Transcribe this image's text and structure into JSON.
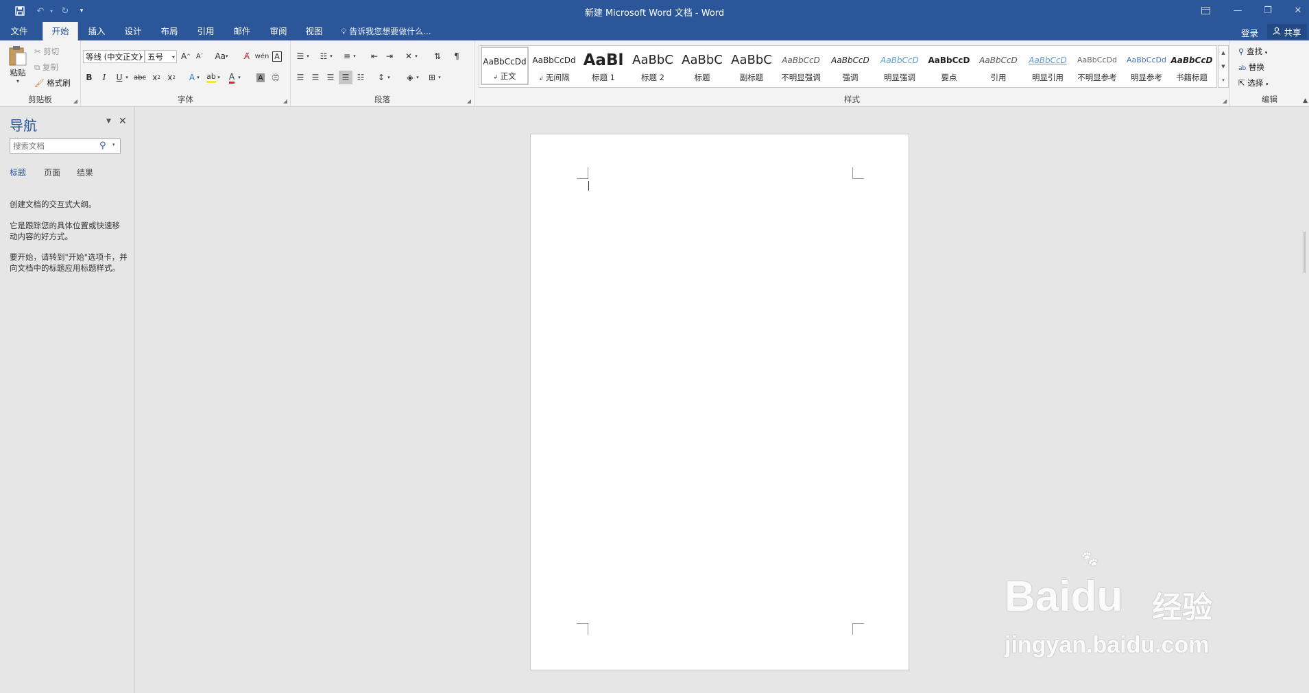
{
  "titlebar": {
    "title": "新建 Microsoft Word 文档 - Word"
  },
  "tabs": [
    "文件",
    "开始",
    "插入",
    "设计",
    "布局",
    "引用",
    "邮件",
    "审阅",
    "视图"
  ],
  "tell_me": "告诉我您想要做什么...",
  "account": {
    "login": "登录",
    "share": "共享"
  },
  "clipboard": {
    "paste": "粘贴",
    "cut": "剪切",
    "copy": "复制",
    "format_painter": "格式刷",
    "label": "剪贴板"
  },
  "font": {
    "name": "等线 (中文正文)",
    "size": "五号",
    "label": "字体"
  },
  "paragraph": {
    "label": "段落"
  },
  "styles": {
    "label": "样式",
    "items": [
      {
        "preview": "AaBbCcDd",
        "name": "正文"
      },
      {
        "preview": "AaBbCcDd",
        "name": "无间隔"
      },
      {
        "preview": "AaBl",
        "name": "标题 1"
      },
      {
        "preview": "AaBbC",
        "name": "标题 2"
      },
      {
        "preview": "AaBbC",
        "name": "标题"
      },
      {
        "preview": "AaBbC",
        "name": "副标题"
      },
      {
        "preview": "AaBbCcD",
        "name": "不明显强调"
      },
      {
        "preview": "AaBbCcD",
        "name": "强调"
      },
      {
        "preview": "AaBbCcD",
        "name": "明显强调"
      },
      {
        "preview": "AaBbCcD",
        "name": "要点"
      },
      {
        "preview": "AaBbCcD",
        "name": "引用"
      },
      {
        "preview": "AaBbCcD",
        "name": "明显引用"
      },
      {
        "preview": "AaBbCcDd",
        "name": "不明显参考"
      },
      {
        "preview": "AaBbCcDd",
        "name": "明显参考"
      },
      {
        "preview": "AaBbCcD",
        "name": "书籍标题"
      }
    ]
  },
  "editing": {
    "find": "查找",
    "replace": "替换",
    "select": "选择",
    "label": "编辑"
  },
  "navigation": {
    "title": "导航",
    "search_placeholder": "搜索文档",
    "tabs": [
      "标题",
      "页面",
      "结果"
    ],
    "texts": [
      "创建文档的交互式大纲。",
      "它是跟踪您的具体位置或快速移动内容的好方式。",
      "要开始，请转到\"开始\"选项卡，并向文档中的标题应用标题样式。"
    ]
  },
  "watermark": {
    "brand": "Baidu",
    "brand_cn": "经验",
    "url": "jingyan.baidu.com"
  },
  "colors": {
    "brand": "#2b579a",
    "ribbon": "#f3f3f3",
    "canvas": "#e6e6e6"
  }
}
